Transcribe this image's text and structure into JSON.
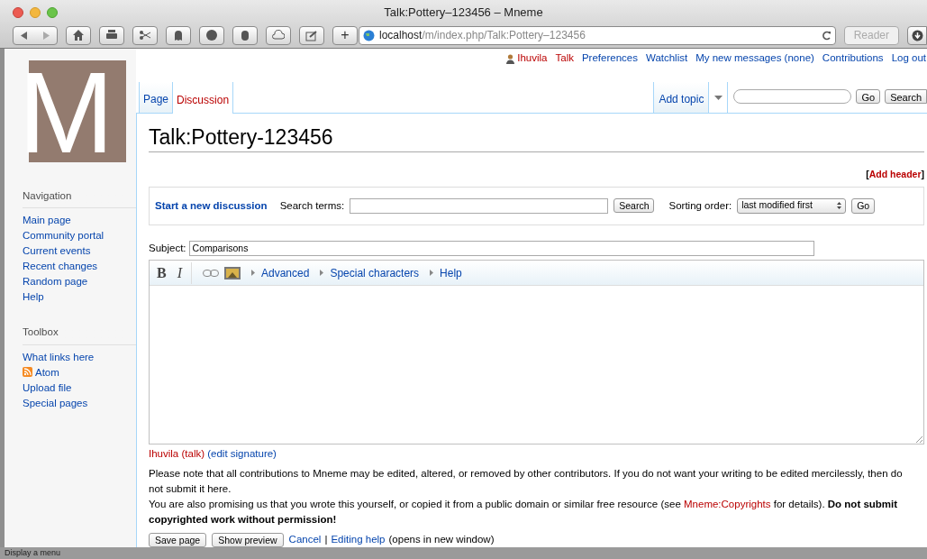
{
  "window": {
    "title": "Talk:Pottery–123456 – Mneme"
  },
  "toolbar": {
    "add": "+",
    "url_host": "localhost",
    "url_path": "/m/index.php/Talk:Pottery–123456",
    "reader": "Reader"
  },
  "logo": {
    "letter": "M"
  },
  "personal_links": [
    {
      "label": "Ihuvila",
      "missing": true,
      "kind": "user"
    },
    {
      "label": "Talk",
      "missing": true,
      "kind": "link"
    },
    {
      "label": "Preferences",
      "missing": false,
      "kind": "link"
    },
    {
      "label": "Watchlist",
      "missing": false,
      "kind": "link"
    },
    {
      "label": "My new messages (none)",
      "missing": false,
      "kind": "link"
    },
    {
      "label": "Contributions",
      "missing": false,
      "kind": "link"
    },
    {
      "label": "Log out",
      "missing": false,
      "kind": "link"
    }
  ],
  "tabs": [
    {
      "label": "Page",
      "selected": false,
      "missing": false
    },
    {
      "label": "Discussion",
      "selected": true,
      "missing": true
    }
  ],
  "actions": {
    "add_topic": "Add topic"
  },
  "search": {
    "go": "Go",
    "search": "Search"
  },
  "heading": "Talk:Pottery-123456",
  "add_header": {
    "open": "[",
    "label": "Add header",
    "close": "]"
  },
  "discussion_bar": {
    "start": "Start a new discussion",
    "search_label": "Search terms:",
    "search_button": "Search",
    "sort_label": "Sorting order:",
    "sort_value": "last modified first",
    "go": "Go"
  },
  "subject": {
    "label": "Subject:",
    "value": "Comparisons"
  },
  "editor": {
    "bold": "B",
    "italic": "I",
    "sections": [
      "Advanced",
      "Special characters",
      "Help"
    ]
  },
  "signature": {
    "user": "Ihuvila",
    "open": "(",
    "talk": "talk",
    "close": ")",
    "edit": "(edit signature)"
  },
  "notice": [
    "Please note that all contributions to Mneme may be edited, altered, or removed by other contributors. If you do not want your writing to be edited mercilessly, then do not submit it here.",
    {
      "before": "You are also promising us that you wrote this yourself, or copied it from a public domain or similar free resource (see ",
      "link": "Mneme:Copyrights",
      "after": " for details). **Do not submit copyrighted work without permission!**"
    }
  ],
  "form_buttons": {
    "save": "Save page",
    "preview": "Show preview",
    "cancel": "Cancel",
    "sep": "|",
    "help": "Editing help",
    "help_note": "(opens in new window)"
  },
  "sidebar": [
    {
      "heading": "Navigation",
      "items": [
        {
          "label": "Main page",
          "kind": "link"
        },
        {
          "label": "Community portal",
          "kind": "link"
        },
        {
          "label": "Current events",
          "kind": "link"
        },
        {
          "label": "Recent changes",
          "kind": "link"
        },
        {
          "label": "Random page",
          "kind": "link"
        },
        {
          "label": "Help",
          "kind": "link"
        }
      ]
    },
    {
      "heading": "Toolbox",
      "items": [
        {
          "label": "What links here",
          "kind": "link"
        },
        {
          "label": "Atom",
          "kind": "feed"
        },
        {
          "label": "Upload file",
          "kind": "link"
        },
        {
          "label": "Special pages",
          "kind": "link"
        }
      ]
    }
  ],
  "status_bar": "Display a menu"
}
